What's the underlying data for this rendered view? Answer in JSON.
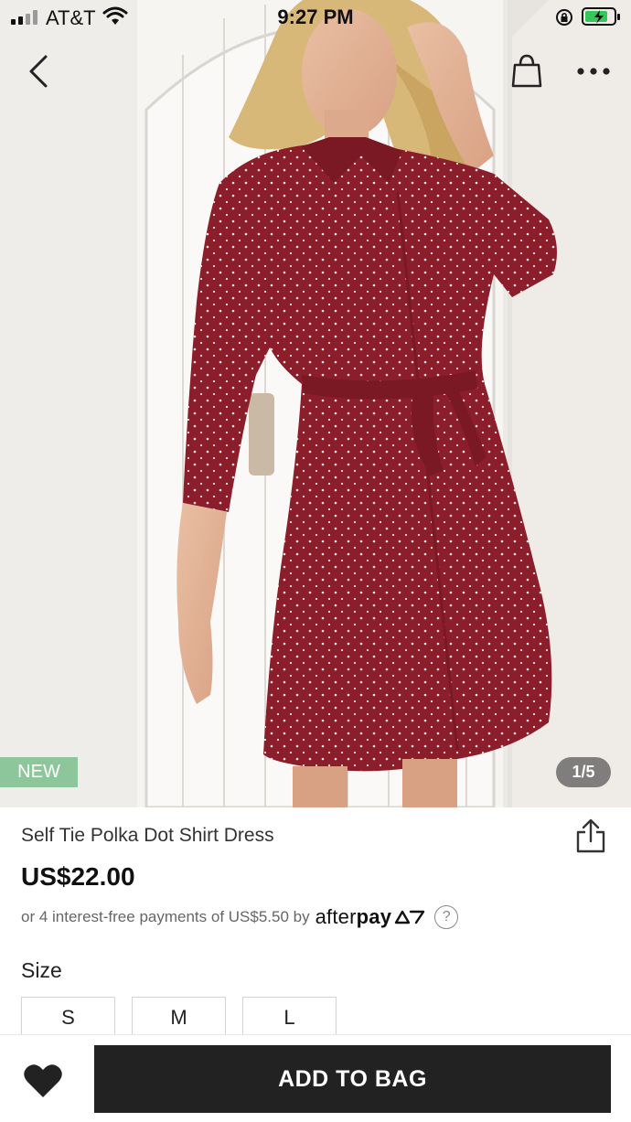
{
  "status_bar": {
    "carrier": "AT&T",
    "time": "9:27 PM"
  },
  "gallery": {
    "badge": "NEW",
    "page_indicator": "1/5",
    "image_subject": "model wearing burgundy polka dot shirt dress"
  },
  "product": {
    "title": "Self Tie Polka Dot Shirt Dress",
    "price": "US$22.00",
    "installments_text": "or 4 interest-free payments of US$5.50 by",
    "afterpay_brand_light": "after",
    "afterpay_brand_bold": "pay",
    "help_glyph": "?"
  },
  "size": {
    "label": "Size",
    "options": [
      "S",
      "M",
      "L"
    ]
  },
  "bottom_bar": {
    "add_to_bag_label": "ADD TO BAG"
  },
  "colors": {
    "dress": "#8b1e2a",
    "new_badge": "#8ec69c",
    "add_button": "#222222"
  },
  "icons": [
    "back-chevron-icon",
    "shopping-bag-icon",
    "more-dots-icon",
    "share-icon",
    "heart-icon",
    "help-icon"
  ]
}
